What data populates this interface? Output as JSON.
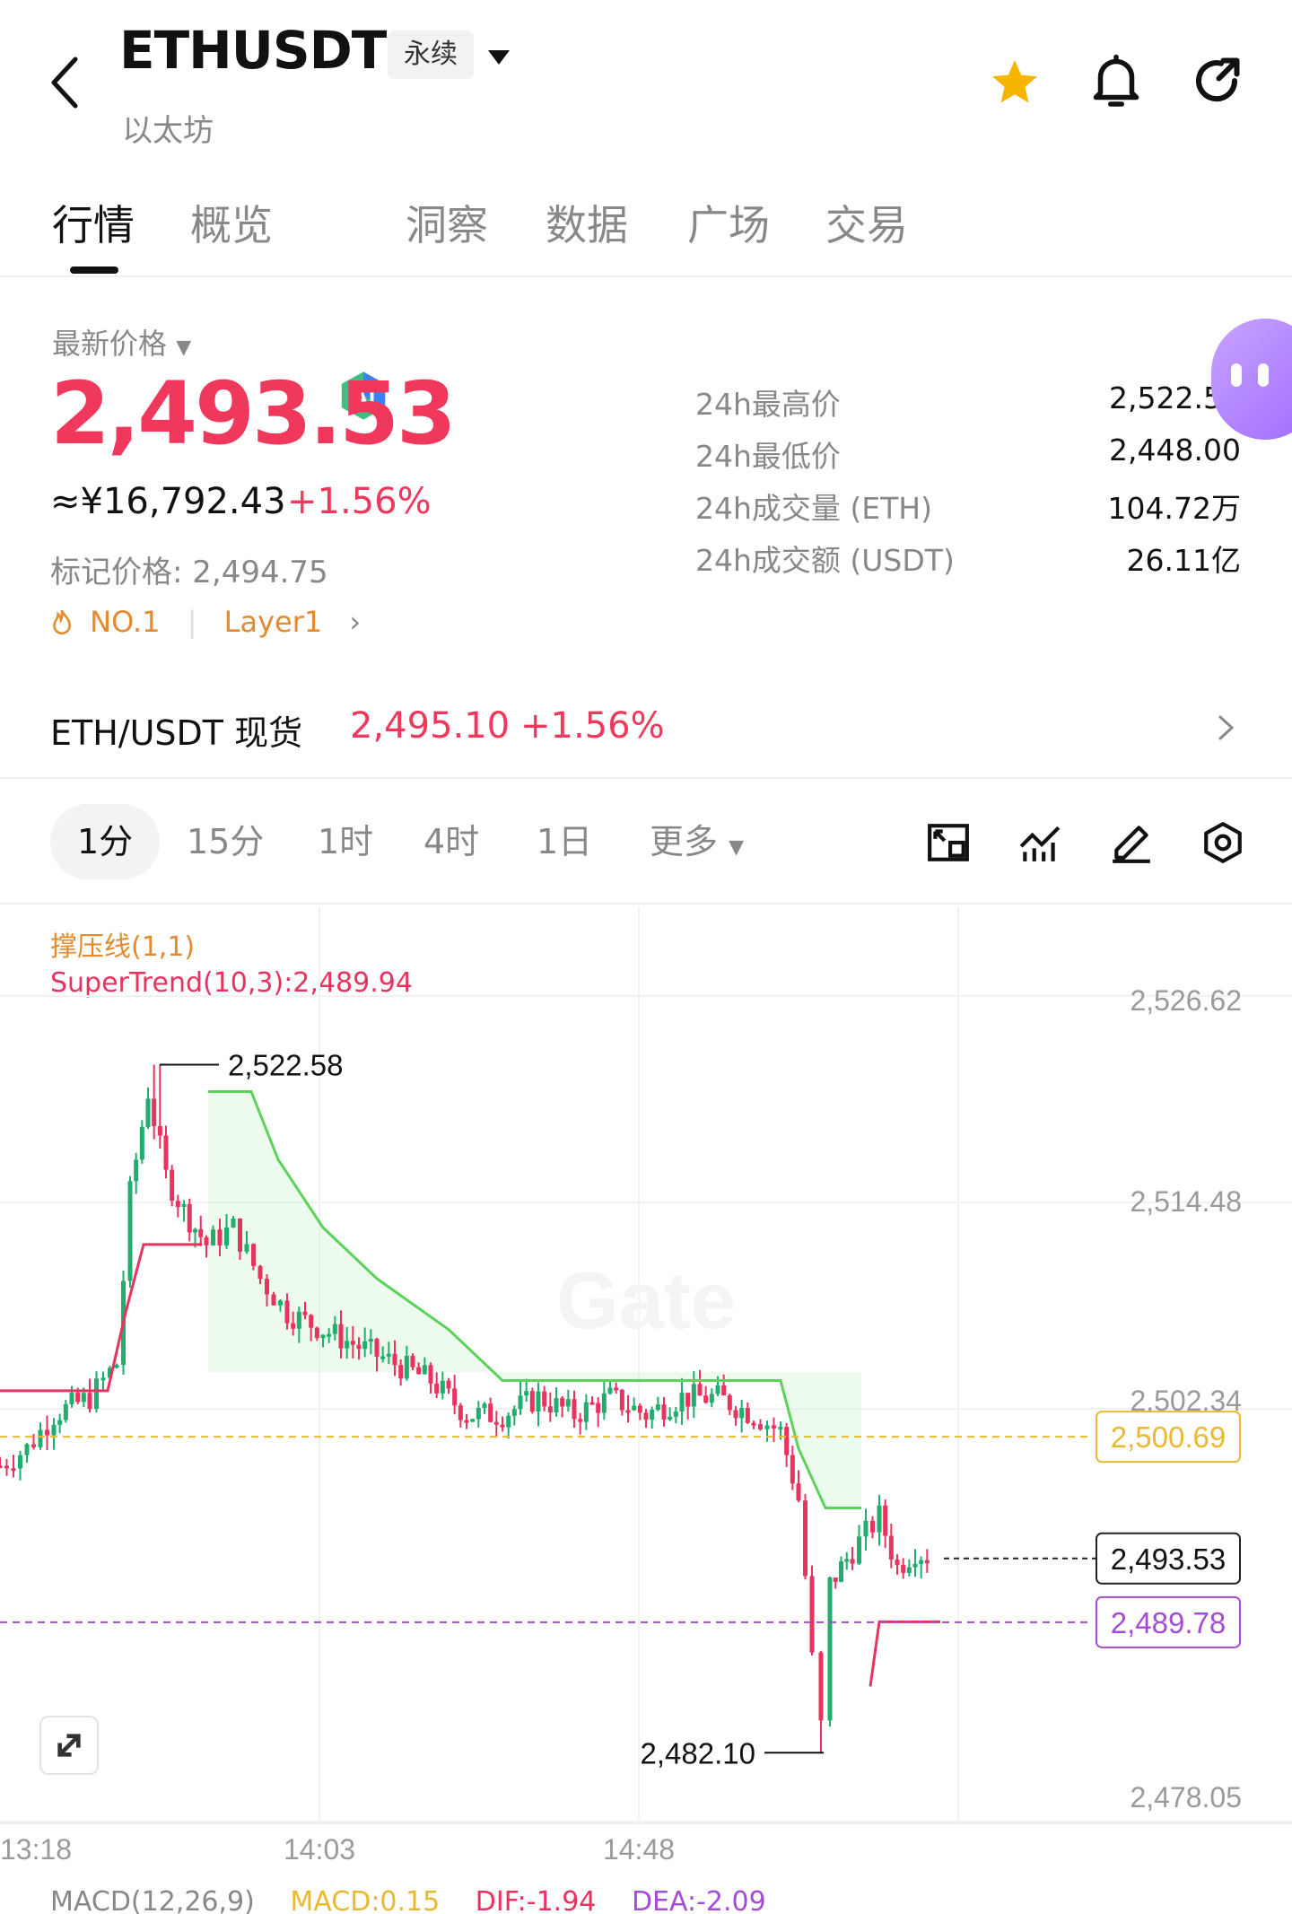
{
  "header": {
    "symbol": "ETHUSDT",
    "contract_type": "永续",
    "subtitle": "以太坊"
  },
  "tabs": [
    {
      "label": "行情",
      "active": true
    },
    {
      "label": "概览"
    },
    {
      "label": "洞察",
      "icon": "ai-icon"
    },
    {
      "label": "数据"
    },
    {
      "label": "广场"
    },
    {
      "label": "交易"
    }
  ],
  "price": {
    "label": "最新价格",
    "last": "2,493.53",
    "cny": "≈¥16,792.43",
    "change": "+1.56%",
    "mark": "标记价格: 2,494.75",
    "rank": "NO.1",
    "sector": "Layer1"
  },
  "stats": [
    {
      "label": "24h最高价",
      "value": "2,522.58"
    },
    {
      "label": "24h最低价",
      "value": "2,448.00"
    },
    {
      "label": "24h成交量 (ETH)",
      "value": "104.72万"
    },
    {
      "label": "24h成交额 (USDT)",
      "value": "26.11亿"
    }
  ],
  "spot": {
    "label": "ETH/USDT 现货",
    "price": "2,495.10",
    "change": "+1.56%"
  },
  "timeframes": [
    {
      "label": "1分",
      "active": true
    },
    {
      "label": "15分"
    },
    {
      "label": "1时"
    },
    {
      "label": "4时"
    },
    {
      "label": "1日"
    },
    {
      "label": "更多"
    }
  ],
  "indicators": {
    "sr": "撑压线(1,1)",
    "supertrend": "SuperTrend(10,3):2,489.94"
  },
  "chart_data": {
    "type": "candlestick",
    "y_ticks": [
      "2,526.62",
      "2,514.48",
      "2,502.34",
      "2,478.05"
    ],
    "x_ticks": [
      "13:18",
      "14:03",
      "14:48"
    ],
    "high_label": "2,522.58",
    "low_label": "2,482.10",
    "resistance": "2,500.69",
    "last_price": "2,493.53",
    "support": "2,489.78",
    "ylim": [
      2478.05,
      2526.62
    ],
    "colors": {
      "up": "#1fae6e",
      "down": "#e8335e",
      "resistance": "#e9b930",
      "support": "#a54cd6"
    }
  },
  "macd": {
    "title": "MACD(12,26,9)",
    "macd": "MACD:0.15",
    "dif": "DIF:-1.94",
    "dea": "DEA:-2.09"
  }
}
